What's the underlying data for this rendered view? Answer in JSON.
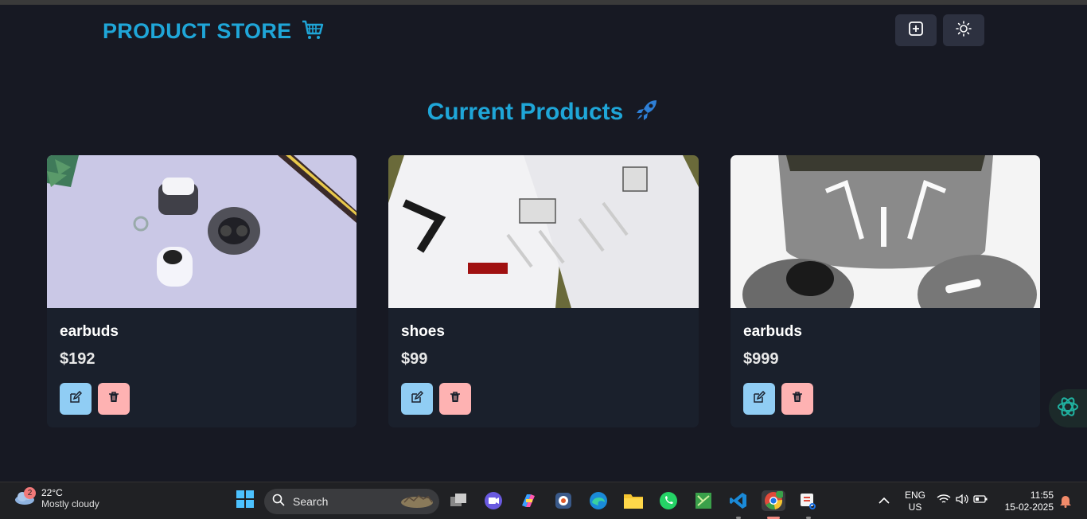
{
  "header": {
    "brand": "PRODUCT STORE",
    "icons": [
      "cart-icon",
      "plus-square-icon",
      "sun-icon"
    ]
  },
  "main": {
    "title": "Current Products",
    "title_icon": "rocket-icon",
    "products": [
      {
        "name": "earbuds",
        "price": "$192"
      },
      {
        "name": "shoes",
        "price": "$99"
      },
      {
        "name": "earbuds",
        "price": "$999"
      }
    ]
  },
  "taskbar": {
    "weather_badge": "2",
    "weather_temp": "22°C",
    "weather_desc": "Mostly cloudy",
    "search_label": "Search",
    "lang_line1": "ENG",
    "lang_line2": "US",
    "time": "11:55",
    "date": "15-02-2025"
  },
  "colors": {
    "accent": "#1fa6d8",
    "edit": "#90cdf4",
    "delete": "#feb2b2",
    "background": "#171923",
    "card": "#1a202c"
  }
}
